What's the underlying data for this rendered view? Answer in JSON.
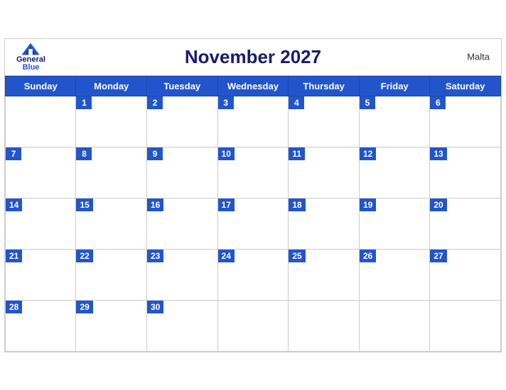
{
  "header": {
    "title": "November 2027",
    "country": "Malta",
    "logo": {
      "general": "General",
      "blue": "Blue"
    }
  },
  "days_of_week": [
    "Sunday",
    "Monday",
    "Tuesday",
    "Wednesday",
    "Thursday",
    "Friday",
    "Saturday"
  ],
  "weeks": [
    [
      null,
      1,
      2,
      3,
      4,
      5,
      6
    ],
    [
      7,
      8,
      9,
      10,
      11,
      12,
      13
    ],
    [
      14,
      15,
      16,
      17,
      18,
      19,
      20
    ],
    [
      21,
      22,
      23,
      24,
      25,
      26,
      27
    ],
    [
      28,
      29,
      30,
      null,
      null,
      null,
      null
    ]
  ]
}
